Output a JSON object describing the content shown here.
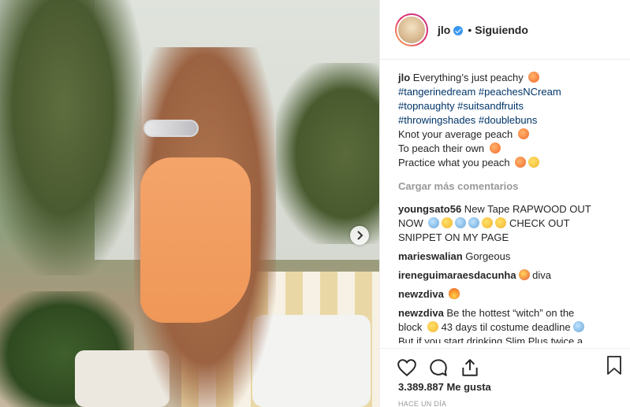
{
  "post": {
    "username": "jlo",
    "follow_status": "Siguiendo",
    "separator": "•",
    "caption_lines": [
      {
        "user": "jlo",
        "text": " Everything’s just peachy "
      },
      {
        "text": "#tangerinedream #peachesNCream"
      },
      {
        "text": "#topnaughty #suitsandfruits"
      },
      {
        "text": "#throwingshades #doublebuns"
      },
      {
        "text": "Knot your average peach "
      },
      {
        "text": "To peach their own "
      },
      {
        "text": "Practice what you peach "
      }
    ],
    "load_more": "Cargar más comentarios",
    "comments": [
      {
        "user": "youngsato56",
        "text": " New Tape RAPWOOD OUT",
        "text2": "NOW ",
        "text2b": " CHECK OUT",
        "text3": "SNIPPET ON MY PAGE"
      },
      {
        "user": "marieswalian",
        "text": " Gorgeous"
      },
      {
        "user": "ireneguimaraesdacunha",
        "text": " diva"
      },
      {
        "user": "newzdiva",
        "text": " "
      },
      {
        "user": "newzdiva",
        "text": " Be the hottest “witch” on the",
        "text2": "block ",
        "text2b": " 43 days til costume deadline",
        "text3": "But if you start drinking Slim Plus twice a"
      }
    ],
    "likes": "3.389.887 Me gusta",
    "time": "HACE UN DÍA"
  },
  "icons": {
    "next": "chevron-right-icon",
    "like": "heart-icon",
    "comment": "comment-icon",
    "share": "share-icon",
    "save": "bookmark-icon",
    "verified": "verified-badge-icon"
  },
  "colors": {
    "hashtag": "#003569",
    "verified": "#3897f0",
    "muted": "#999999",
    "text": "#262626"
  }
}
